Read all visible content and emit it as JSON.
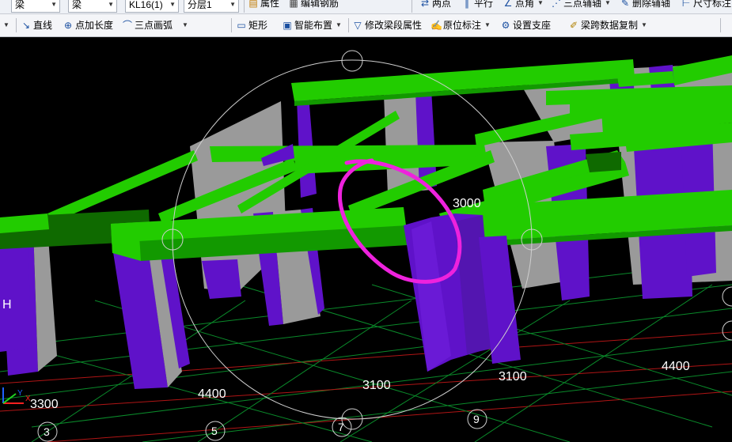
{
  "toolbar_top": {
    "combo_type": "梁",
    "combo_subtype": "梁",
    "combo_element": "KL16(1)",
    "combo_layer": "分层1",
    "properties_label": "属性",
    "edit_rebar_label": "编辑钢筋",
    "two_points_label": "两点",
    "parallel_label": "平行",
    "point_angle_label": "点角",
    "three_point_axis_label": "三点辅轴",
    "delete_axis_label": "删除辅轴",
    "dimension_label": "尺寸标注"
  },
  "toolbar_second": {
    "line_label": "直线",
    "point_extend_label": "点加长度",
    "arc_label": "三点画弧",
    "rect_label": "矩形",
    "smart_layout_label": "智能布置",
    "modify_segment_label": "修改梁段属性",
    "origin_mark_label": "原位标注",
    "set_support_label": "设置支座",
    "copy_span_label": "梁跨数据复制"
  },
  "viewport": {
    "dimensions": {
      "d1": "3000",
      "d2": "4400",
      "d3": "3100",
      "d4": "3100",
      "d5": "4400",
      "d6": "3300"
    },
    "axis_markers": {
      "a1": "3",
      "a2": "5",
      "a3": "7",
      "a4": "9"
    },
    "coord_labels": {
      "x": "X",
      "y": "Y",
      "side": "H"
    },
    "colors": {
      "beam": "#22cc00",
      "beam_dark": "#0f6a00",
      "column": "#5f12c9",
      "wall": "#9a9a9a",
      "highlight": "#ee22dd",
      "background": "#000000"
    }
  }
}
